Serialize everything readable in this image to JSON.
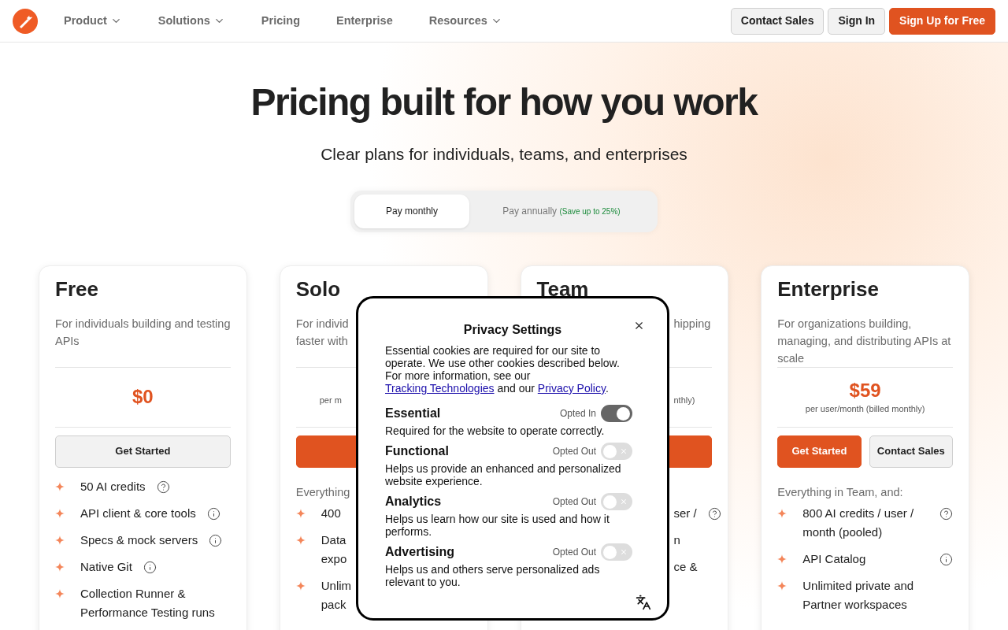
{
  "nav": {
    "items": [
      {
        "label": "Product",
        "kind": "dropdown"
      },
      {
        "label": "Solutions",
        "kind": "dropdown"
      },
      {
        "label": "Pricing",
        "kind": "link"
      },
      {
        "label": "Enterprise",
        "kind": "link"
      },
      {
        "label": "Resources",
        "kind": "dropdown"
      }
    ],
    "buttons": [
      {
        "label": "Contact Sales",
        "kind": "secondary"
      },
      {
        "label": "Sign In",
        "kind": "secondary"
      },
      {
        "label": "Sign Up for Free",
        "kind": "primary"
      }
    ]
  },
  "hero": {
    "title": "Pricing built for how you work",
    "subtitle": "Clear plans for individuals, teams, and enterprises"
  },
  "billing": [
    {
      "label": "Pay monthly",
      "selected": true
    },
    {
      "label": "Pay annually",
      "note": "(Save up to 25%)",
      "selected": false
    }
  ],
  "plans": [
    {
      "name": "Free",
      "description": "For individuals building and testing APIs",
      "price": "$0",
      "buttons": [
        {
          "label": "Get Started",
          "kind": "secondary"
        }
      ],
      "features": [
        {
          "text": "50 AI credits",
          "kind": "help",
          "bullet": true
        },
        {
          "text": "API client & core tools",
          "kind": "info",
          "bullet": true
        },
        {
          "text": "Specs & mock servers",
          "kind": "info",
          "bullet": true
        },
        {
          "text": "Native Git",
          "kind": "info",
          "bullet": true
        },
        {
          "text": "Collection Runner & Performance Testing runs",
          "bullet": true
        }
      ]
    },
    {
      "name": "Solo",
      "description": "For individ\nfaster with",
      "price_note": "per m",
      "buttons": [
        {
          "kind": "primary"
        }
      ],
      "intro": "Everything",
      "features": [
        {
          "text": "400",
          "bullet": true
        },
        {
          "text": "Data\nexpo",
          "bullet": true
        },
        {
          "text": "Unlim\npack",
          "bullet": true
        }
      ]
    },
    {
      "name": "Team",
      "description": "hipping",
      "price_note": "nthly)",
      "buttons": [
        {
          "kind": "primary"
        }
      ],
      "features": [
        {
          "text": "ser /",
          "kind": "help",
          "bullet": false
        },
        {
          "text": "n",
          "bullet": false
        },
        {
          "text": "ce &",
          "bullet": false
        }
      ]
    },
    {
      "name": "Enterprise",
      "description": "For organizations building, managing, and distributing APIs at scale",
      "price": "$59",
      "price_note": "per user/month (billed monthly)",
      "buttons": [
        {
          "label": "Get Started",
          "kind": "primary"
        },
        {
          "label": "Contact Sales",
          "kind": "secondary"
        }
      ],
      "intro": "Everything in Team, and:",
      "features": [
        {
          "text": "800 AI credits / user / month (pooled)",
          "kind": "help",
          "bullet": true
        },
        {
          "text": "API Catalog",
          "kind": "info",
          "bullet": true
        },
        {
          "text": "Unlimited private and Partner workspaces",
          "bullet": true
        }
      ]
    }
  ],
  "privacy_dialog": {
    "title": "Privacy Settings",
    "body": [
      {
        "kind": "text",
        "text": "Essential cookies are required for our site to operate. We use other cookies described below. For more information, see our "
      },
      {
        "kind": "link",
        "text": "Tracking Technologies"
      },
      {
        "kind": "text",
        "text": " and our "
      },
      {
        "kind": "link",
        "text": "Privacy Policy"
      },
      {
        "kind": "text",
        "text": "."
      }
    ],
    "categories": [
      {
        "name": "Essential",
        "status": "Opted In",
        "on": true,
        "description": "Required for the website to operate correctly."
      },
      {
        "name": "Functional",
        "status": "Opted Out",
        "on": false,
        "description": "Helps us provide an enhanced and personalized website experience."
      },
      {
        "name": "Analytics",
        "status": "Opted Out",
        "on": false,
        "description": "Helps us learn how our site is used and how it performs."
      },
      {
        "name": "Advertising",
        "status": "Opted Out",
        "on": false,
        "description": "Helps us and others serve personalized ads relevant to you."
      }
    ]
  }
}
